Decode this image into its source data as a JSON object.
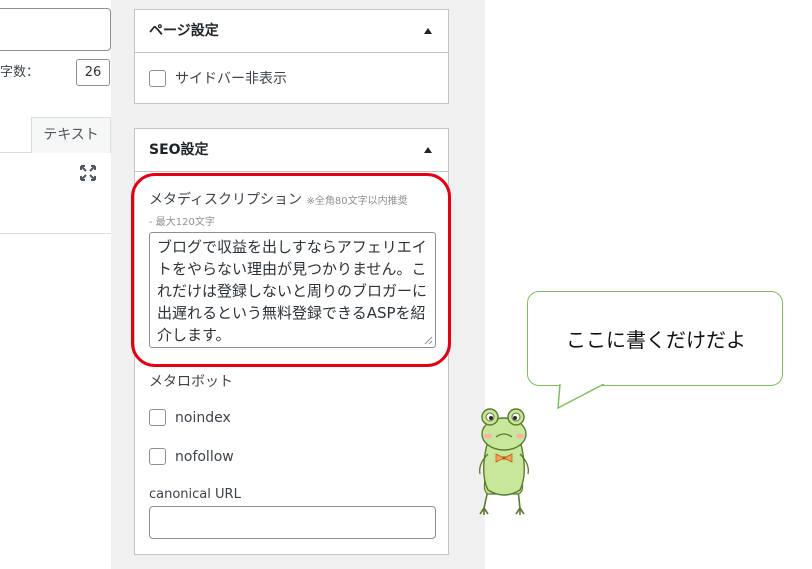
{
  "editor": {
    "char_count_label": "字数：",
    "char_count_value": "26",
    "tab_text": "テキスト"
  },
  "page_settings": {
    "title": "ページ設定",
    "hide_sidebar_label": "サイドバー非表示"
  },
  "seo_settings": {
    "title": "SEO設定",
    "meta_description_label": "メタディスクリプション",
    "meta_description_note": "※全角80文字以内推奨",
    "meta_description_note_2": "- 最大120文字",
    "meta_description_value": "ブログで収益を出しすならアフェリエイトをやらない理由が見つかりません。これだけは登録しないと周りのブロガーに出遅れるという無料登録できるASPを紹介します。",
    "meta_robots_label": "メタロボット",
    "noindex_label": "noindex",
    "nofollow_label": "nofollow",
    "canonical_label": "canonical URL",
    "canonical_value": ""
  },
  "annotation": {
    "speech_text": "ここに書くだけだよ",
    "highlight_color": "#e50012",
    "bubble_border_color": "#7fbf5a"
  }
}
